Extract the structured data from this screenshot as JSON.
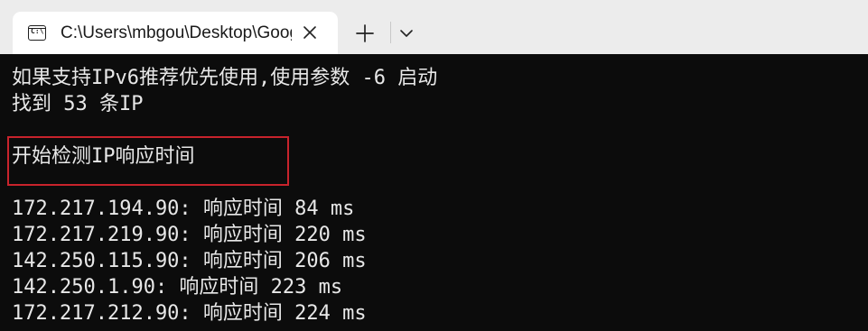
{
  "tab": {
    "icon": "terminal-icon",
    "title": "C:\\Users\\mbgou\\Desktop\\GoogleTranslateIpCheck.exe"
  },
  "tabbar": {
    "new_tab_icon": "plus-icon",
    "dropdown_icon": "chevron-down-icon",
    "close_icon": "close-icon"
  },
  "terminal": {
    "lines": [
      "如果支持IPv6推荐优先使用,使用参数 -6 启动",
      "找到 53 条IP",
      "开始检测IP响应时间",
      "172.217.194.90: 响应时间 84 ms",
      "172.217.219.90: 响应时间 220 ms",
      "142.250.115.90: 响应时间 206 ms",
      "142.250.1.90: 响应时间 223 ms",
      "172.217.212.90: 响应时间 224 ms"
    ]
  },
  "colors": {
    "tabbar_bg": "#ececec",
    "tab_bg": "#ffffff",
    "terminal_bg": "#0c0c0c",
    "terminal_text": "#e8e8e8",
    "highlight_border": "#c8232c"
  }
}
